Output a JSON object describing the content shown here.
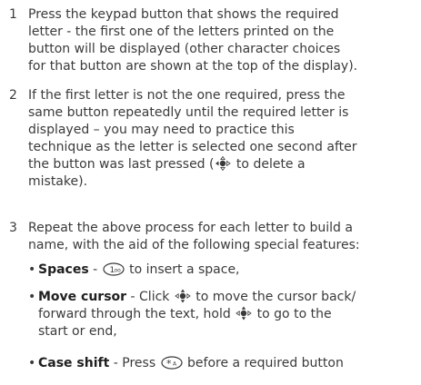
{
  "steps": [
    {
      "number": "1",
      "lines": [
        "Press the keypad button that shows the required",
        "letter - the first one of the letters printed on the",
        "button will be displayed (other character choices",
        "for that button are shown at the top of the display)."
      ]
    },
    {
      "number": "2",
      "lines": [
        "If the first letter is not the one required, press the",
        "same button repeatedly until the required letter is",
        "displayed – you may need to practice this",
        "technique as the letter is selected one second after",
        "the button was last pressed (",
        " to delete a",
        "mistake)."
      ]
    },
    {
      "number": "3",
      "lines": [
        "Repeat the above process for each letter to build a",
        "name, with the aid of the following special features:"
      ]
    }
  ],
  "bullets": [
    {
      "marker": "•",
      "term": "Spaces",
      "parts": [
        " - ",
        " to insert a space,"
      ]
    },
    {
      "marker": "•",
      "term": "Move cursor",
      "parts": [
        " - Click ",
        " to move the cursor back/",
        "forward through the text, hold ",
        " to go to the",
        "start or end,"
      ]
    },
    {
      "marker": "•",
      "term": "Case shift",
      "parts": [
        " - Press ",
        " before a required button"
      ]
    }
  ],
  "icons": {
    "joystick_left": "navigation-key-left-icon",
    "joystick_updown": "navigation-key-up-down-icon",
    "space_key": "key-1-space-icon",
    "star_key": "key-star-icon"
  },
  "key_labels": {
    "space": "1",
    "space_sub": "oo",
    "star": "*",
    "star_sub": "A"
  }
}
